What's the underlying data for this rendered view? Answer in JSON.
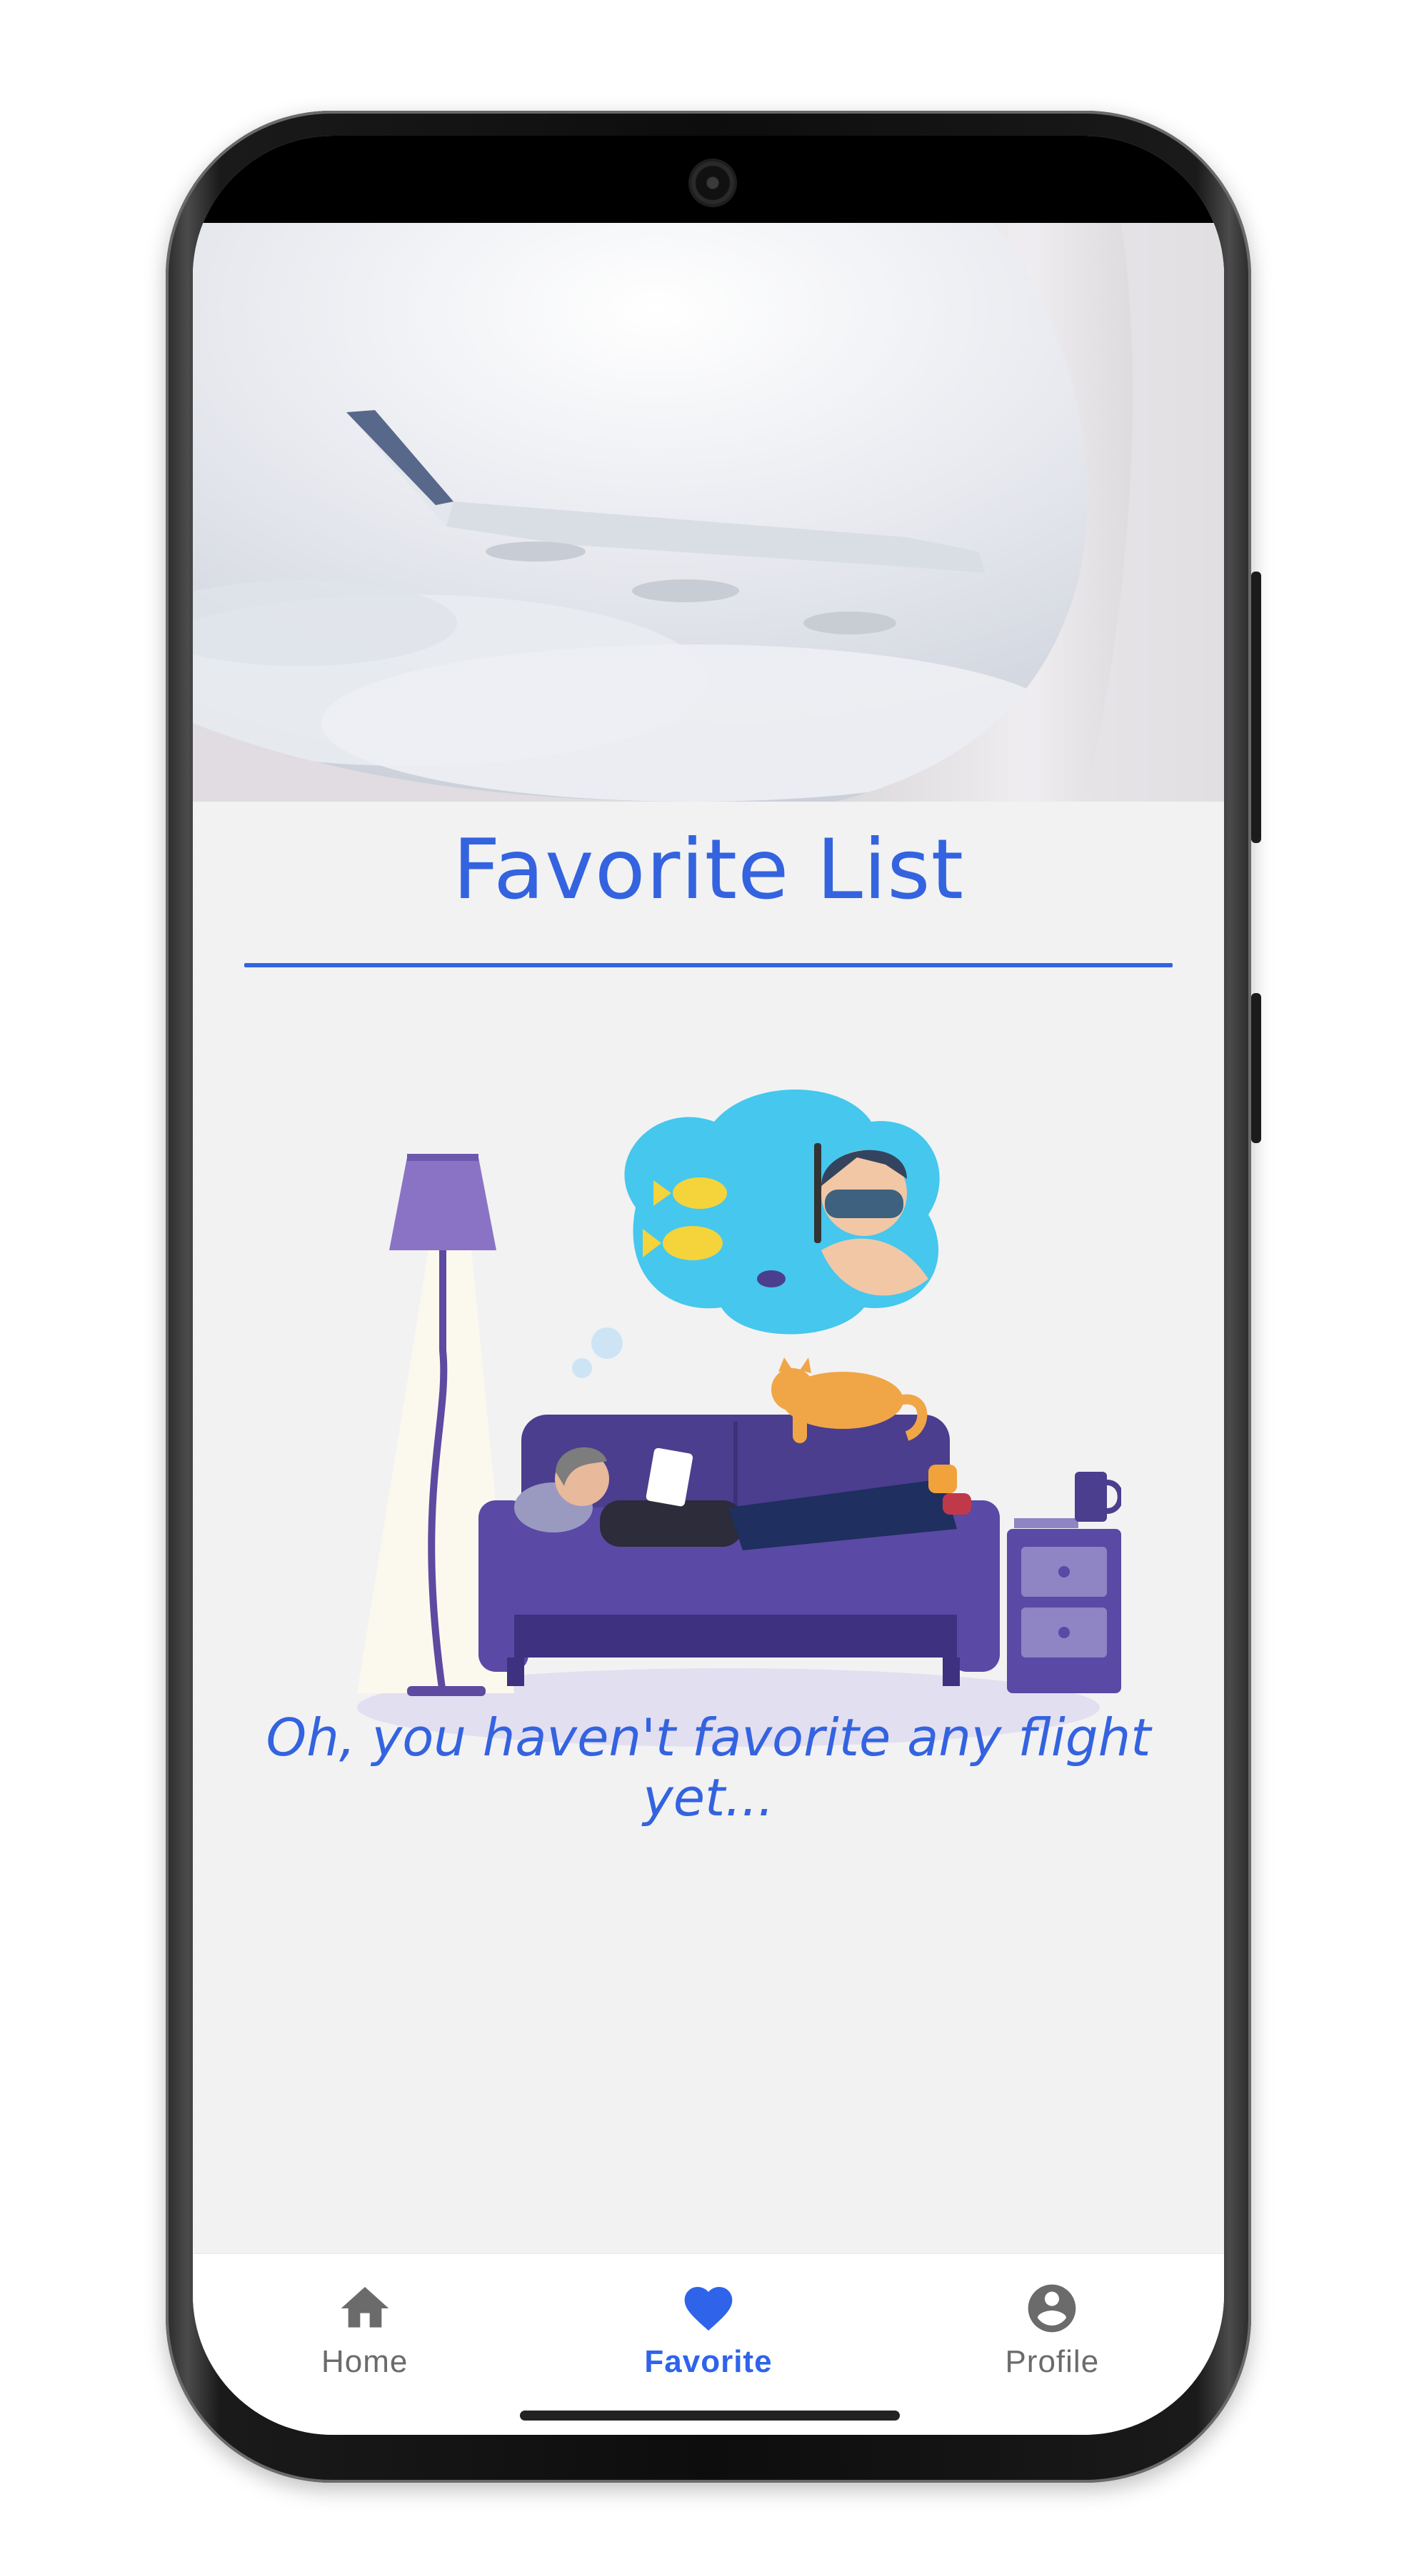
{
  "page": {
    "title": "Favorite List",
    "empty_message": "Oh, you haven't favorite any flight yet..."
  },
  "bottom_nav": {
    "active": "favorite",
    "items": [
      {
        "label": "Home",
        "icon": "home-icon"
      },
      {
        "label": "Favorite",
        "icon": "heart-icon"
      },
      {
        "label": "Profile",
        "icon": "account-circle-icon"
      }
    ]
  },
  "colors": {
    "accent": "#3463e0",
    "inactive": "#6b6b6b",
    "background": "#f2f2f3"
  }
}
